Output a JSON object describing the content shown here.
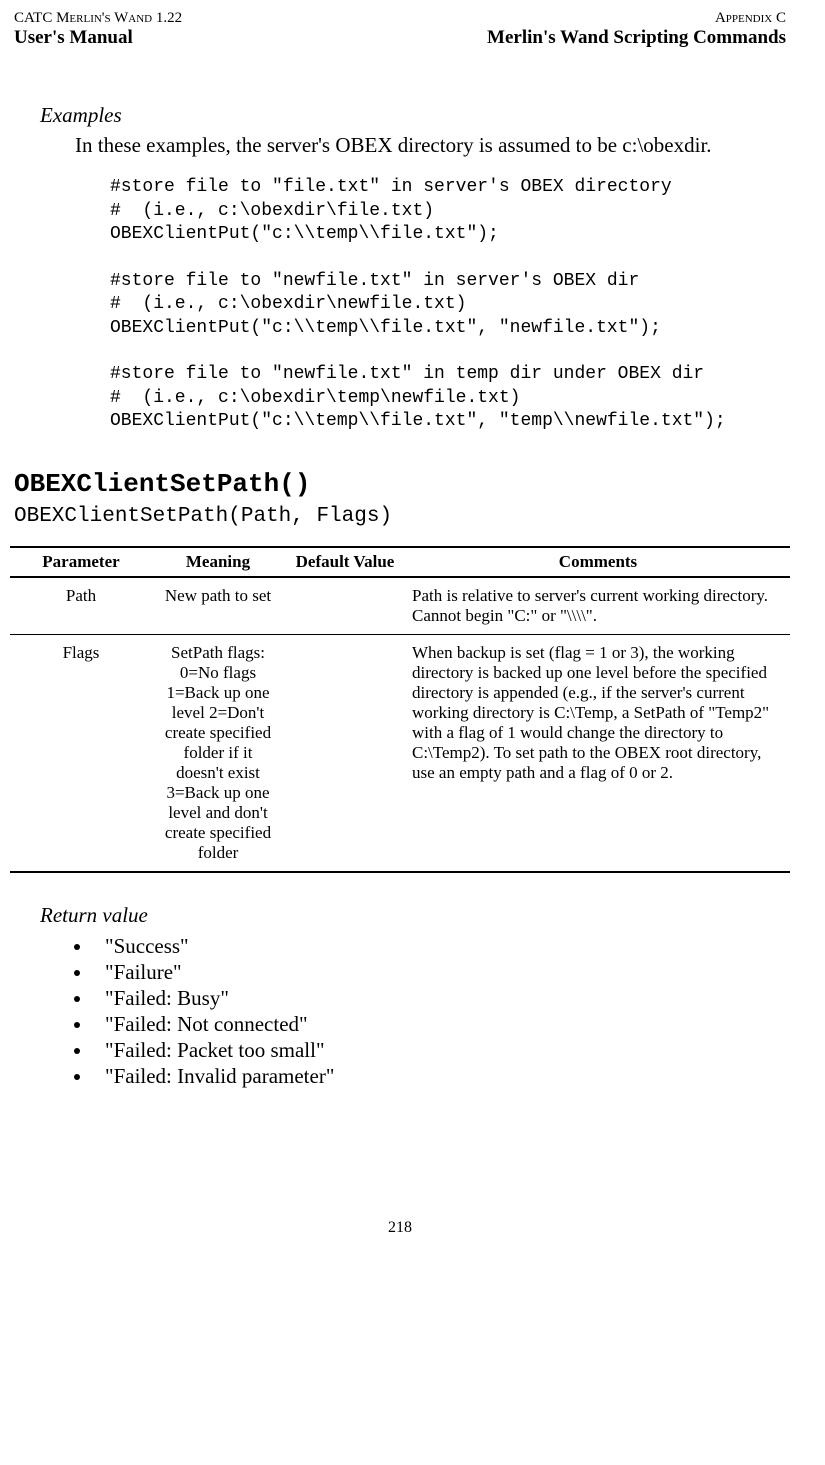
{
  "header": {
    "left": "CATC Merlin's Wand 1.22",
    "right": "Appendix C",
    "subleft": "User's Manual",
    "subright": "Merlin's Wand Scripting Commands"
  },
  "examples": {
    "heading": "Examples",
    "intro": "In these examples, the server's OBEX directory is assumed to be c:\\obexdir.",
    "code": "#store file to \"file.txt\" in server's OBEX directory\n#  (i.e., c:\\obexdir\\file.txt)\nOBEXClientPut(\"c:\\\\temp\\\\file.txt\");\n\n#store file to \"newfile.txt\" in server's OBEX dir\n#  (i.e., c:\\obexdir\\newfile.txt)\nOBEXClientPut(\"c:\\\\temp\\\\file.txt\", \"newfile.txt\");\n\n#store file to \"newfile.txt\" in temp dir under OBEX dir\n#  (i.e., c:\\obexdir\\temp\\newfile.txt)\nOBEXClientPut(\"c:\\\\temp\\\\file.txt\", \"temp\\\\newfile.txt\");"
  },
  "function": {
    "name": "OBEXClientSetPath()",
    "signature": "OBEXClientSetPath(Path, Flags)"
  },
  "table": {
    "headers": {
      "parameter": "Parameter",
      "meaning": "Meaning",
      "default": "Default Value",
      "comments": "Comments"
    },
    "rows": [
      {
        "parameter": "Path",
        "meaning": "New path to set",
        "default": "",
        "comments": "Path is relative to server's current working directory. Cannot begin \"C:\" or \"\\\\\\\\\"."
      },
      {
        "parameter": "Flags",
        "meaning": "SetPath flags: 0=No flags 1=Back up one level 2=Don't create specified folder if it doesn't exist 3=Back up one level and don't create specified folder",
        "default": "",
        "comments": "When backup is set (flag = 1 or 3), the working directory is backed up one level before the specified directory is appended (e.g., if the server's current working directory is C:\\Temp, a SetPath of \"Temp2\" with a flag of 1 would change the directory to C:\\Temp2).  To set path to the OBEX root directory, use an empty path and a flag of 0 or 2."
      }
    ]
  },
  "returns": {
    "heading": "Return value",
    "items": [
      "\"Success\"",
      "\"Failure\"",
      "\"Failed: Busy\"",
      "\"Failed: Not connected\"",
      "\"Failed: Packet too small\"",
      "\"Failed: Invalid parameter\""
    ]
  },
  "page_number": "218"
}
